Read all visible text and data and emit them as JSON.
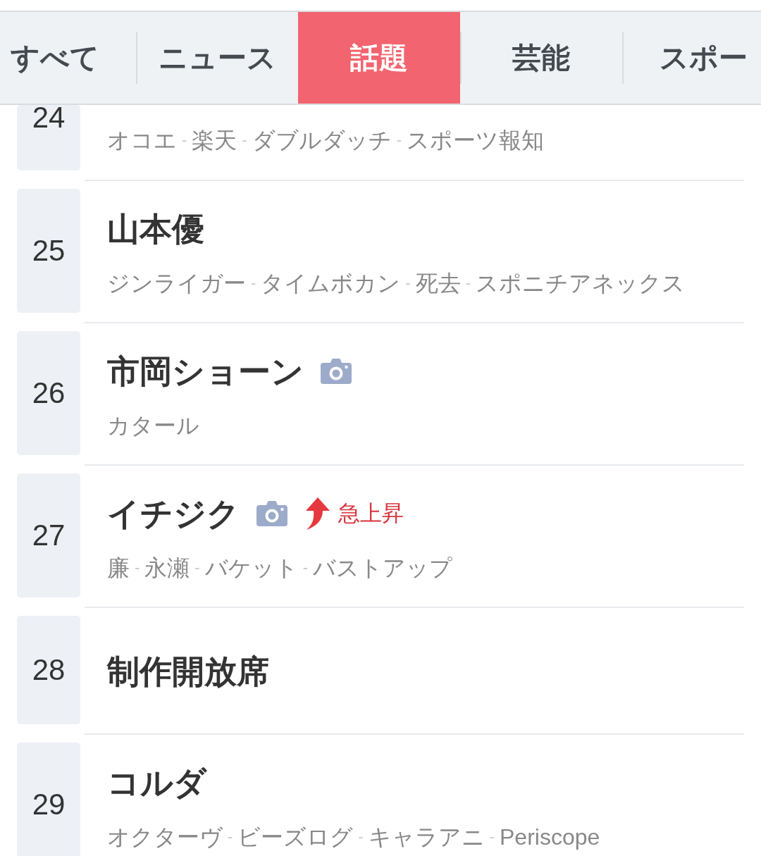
{
  "tabs": [
    {
      "label": "すべて",
      "selected": false
    },
    {
      "label": "ニュース",
      "selected": false
    },
    {
      "label": "話題",
      "selected": true
    },
    {
      "label": "芸能",
      "selected": false
    },
    {
      "label": "スポー",
      "selected": false
    }
  ],
  "ranking": [
    {
      "rank": "24",
      "keywords": [
        {
          "kind": "keyword",
          "text": "オコエ"
        },
        {
          "kind": "separator",
          "text": "-"
        },
        {
          "kind": "keyword",
          "text": "楽天"
        },
        {
          "kind": "separator",
          "text": "-"
        },
        {
          "kind": "keyword",
          "text": "ダブルダッチ"
        },
        {
          "kind": "separator",
          "text": "-"
        },
        {
          "kind": "keyword",
          "text": "スポーツ報知"
        }
      ]
    },
    {
      "rank": "25",
      "title": "山本優",
      "photo": false,
      "keywords": [
        {
          "kind": "keyword",
          "text": "ジンライガー"
        },
        {
          "kind": "separator",
          "text": "-"
        },
        {
          "kind": "keyword",
          "text": "タイムボカン"
        },
        {
          "kind": "separator",
          "text": "-"
        },
        {
          "kind": "keyword",
          "text": "死去"
        },
        {
          "kind": "separator",
          "text": "-"
        },
        {
          "kind": "keyword",
          "text": "スポニチアネックス"
        }
      ]
    },
    {
      "rank": "26",
      "title": "市岡ショーン",
      "photo": true,
      "keywords": [
        {
          "kind": "keyword",
          "text": "カタール"
        }
      ]
    },
    {
      "rank": "27",
      "title": "イチジク",
      "photo": true,
      "badge": {
        "kind": "rising",
        "label": "急上昇"
      },
      "keywords": [
        {
          "kind": "keyword",
          "text": "廉"
        },
        {
          "kind": "separator",
          "text": "-"
        },
        {
          "kind": "keyword",
          "text": "永瀬"
        },
        {
          "kind": "separator",
          "text": "-"
        },
        {
          "kind": "keyword",
          "text": "バケット"
        },
        {
          "kind": "separator",
          "text": "-"
        },
        {
          "kind": "keyword",
          "text": "バストアップ"
        }
      ]
    },
    {
      "rank": "28",
      "title": "制作開放席",
      "photo": false
    },
    {
      "rank": "29",
      "title": "コルダ",
      "photo": false,
      "keywords": [
        {
          "kind": "keyword",
          "text": "オクターヴ"
        },
        {
          "kind": "separator",
          "text": "-"
        },
        {
          "kind": "keyword",
          "text": "ビーズログ"
        },
        {
          "kind": "separator",
          "text": "-"
        },
        {
          "kind": "keyword",
          "text": "キャラアニ"
        },
        {
          "kind": "separator",
          "text": "-"
        },
        {
          "kind": "keyword",
          "text": "Periscope"
        }
      ]
    }
  ]
}
